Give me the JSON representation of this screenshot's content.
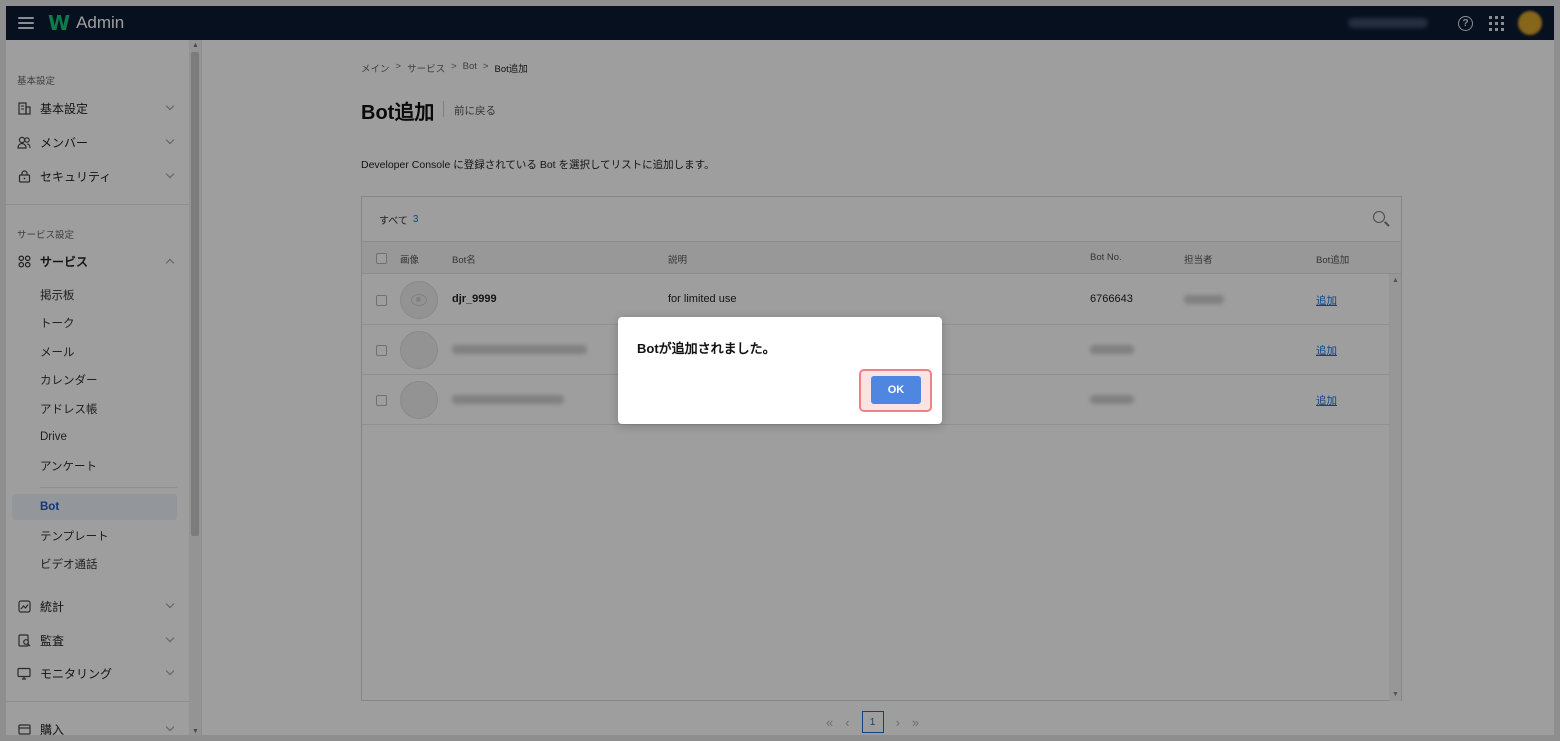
{
  "app": {
    "title": "Admin"
  },
  "sidebar": {
    "section_basic": "基本設定",
    "basic_items": [
      "基本設定",
      "メンバー",
      "セキュリティ"
    ],
    "section_service": "サービス設定",
    "service_label": "サービス",
    "service_sub": [
      "掲示板",
      "トーク",
      "メール",
      "カレンダー",
      "アドレス帳",
      "Drive",
      "アンケート"
    ],
    "service_sub2": [
      "Bot",
      "テンプレート",
      "ビデオ通話"
    ],
    "active_sub": "Bot",
    "other_items": [
      "統計",
      "監査",
      "モニタリング"
    ],
    "bottom_item": "購入"
  },
  "breadcrumb": [
    "メイン",
    "サービス",
    "Bot",
    "Bot追加"
  ],
  "breadcrumb_sep": ">",
  "page": {
    "title": "Bot追加",
    "back": "前に戻る",
    "description": "Developer Console に登録されている Bot を選択してリストに追加します。"
  },
  "table": {
    "filter_label": "すべて",
    "filter_count": "3",
    "headers": {
      "image": "画像",
      "name": "Bot名",
      "desc": "説明",
      "no": "Bot No.",
      "owner": "担当者",
      "add": "Bot追加"
    },
    "rows": [
      {
        "name": "djr_9999",
        "desc": "for limited use",
        "no": "6766643",
        "add": "追加"
      },
      {
        "name": "",
        "desc": "",
        "no": "",
        "add": "追加"
      },
      {
        "name": "",
        "desc": "",
        "no": "",
        "add": "追加"
      }
    ]
  },
  "pagination": {
    "first": "«",
    "prev": "‹",
    "current": "1",
    "next": "›",
    "last": "»"
  },
  "modal": {
    "message": "Botが追加されました。",
    "ok": "OK"
  },
  "colors": {
    "topbar": "#0b1a33",
    "accent": "#1a6fd1",
    "ok_button": "#4f86e0",
    "highlight": "#f07f86"
  }
}
